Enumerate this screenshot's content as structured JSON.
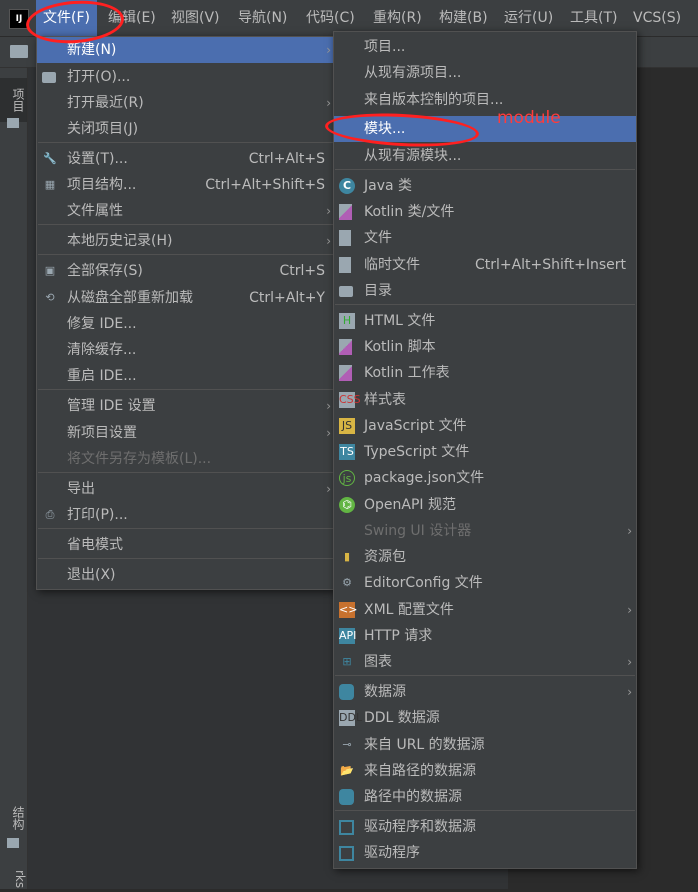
{
  "menubar": {
    "app_icon": "IJ",
    "items": [
      "文件(F)",
      "编辑(E)",
      "视图(V)",
      "导航(N)",
      "代码(C)",
      "重构(R)",
      "构建(B)",
      "运行(U)",
      "工具(T)",
      "VCS(S)"
    ]
  },
  "left_strip": {
    "project": "项目",
    "structure": "结构",
    "bookmarks": "rks"
  },
  "file_menu": {
    "items": [
      {
        "label": "新建(N)",
        "icon": "none",
        "shortcut": "",
        "submenu": true,
        "selected": true
      },
      {
        "label": "打开(O)...",
        "icon": "folder-icon",
        "shortcut": ""
      },
      {
        "label": "打开最近(R)",
        "icon": "none",
        "shortcut": "",
        "submenu": true
      },
      {
        "label": "关闭项目(J)",
        "icon": "none",
        "shortcut": ""
      },
      {
        "label": "设置(T)...",
        "icon": "wrench-icon",
        "shortcut": "Ctrl+Alt+S"
      },
      {
        "label": "项目结构...",
        "icon": "project-structure-icon",
        "shortcut": "Ctrl+Alt+Shift+S"
      },
      {
        "label": "文件属性",
        "icon": "none",
        "shortcut": "",
        "submenu": true
      },
      {
        "label": "本地历史记录(H)",
        "icon": "none",
        "shortcut": "",
        "submenu": true
      },
      {
        "label": "全部保存(S)",
        "icon": "save-icon",
        "shortcut": "Ctrl+S"
      },
      {
        "label": "从磁盘全部重新加载",
        "icon": "reload-icon",
        "shortcut": "Ctrl+Alt+Y"
      },
      {
        "label": "修复 IDE...",
        "icon": "none",
        "shortcut": ""
      },
      {
        "label": "清除缓存...",
        "icon": "none",
        "shortcut": ""
      },
      {
        "label": "重启 IDE...",
        "icon": "none",
        "shortcut": ""
      },
      {
        "label": "管理 IDE 设置",
        "icon": "none",
        "shortcut": "",
        "submenu": true
      },
      {
        "label": "新项目设置",
        "icon": "none",
        "shortcut": "",
        "submenu": true
      },
      {
        "label": "将文件另存为模板(L)...",
        "icon": "none",
        "shortcut": "",
        "disabled": true
      },
      {
        "label": "导出",
        "icon": "none",
        "shortcut": "",
        "submenu": true
      },
      {
        "label": "打印(P)...",
        "icon": "print-icon",
        "shortcut": ""
      },
      {
        "label": "省电模式",
        "icon": "none",
        "shortcut": ""
      },
      {
        "label": "退出(X)",
        "icon": "none",
        "shortcut": ""
      }
    ]
  },
  "new_menu": {
    "items": [
      {
        "label": "项目...",
        "icon": "none"
      },
      {
        "label": "从现有源项目...",
        "icon": "none"
      },
      {
        "label": "来自版本控制的项目...",
        "icon": "none"
      },
      {
        "label": "模块...",
        "icon": "none",
        "selected": true
      },
      {
        "label": "从现有源模块...",
        "icon": "none"
      },
      {
        "label": "Java 类",
        "icon": "java-class-icon"
      },
      {
        "label": "Kotlin 类/文件",
        "icon": "kotlin-icon"
      },
      {
        "label": "文件",
        "icon": "file-icon"
      },
      {
        "label": "临时文件",
        "icon": "scratch-file-icon",
        "shortcut": "Ctrl+Alt+Shift+Insert"
      },
      {
        "label": "目录",
        "icon": "folder-icon"
      },
      {
        "label": "HTML 文件",
        "icon": "html-icon"
      },
      {
        "label": "Kotlin 脚本",
        "icon": "kotlin-icon"
      },
      {
        "label": "Kotlin 工作表",
        "icon": "kotlin-icon"
      },
      {
        "label": "样式表",
        "icon": "css-icon"
      },
      {
        "label": "JavaScript 文件",
        "icon": "js-icon"
      },
      {
        "label": "TypeScript 文件",
        "icon": "ts-icon"
      },
      {
        "label": "package.json文件",
        "icon": "package-json-icon"
      },
      {
        "label": "OpenAPI 规范",
        "icon": "openapi-icon"
      },
      {
        "label": "Swing UI 设计器",
        "icon": "none",
        "disabled": true,
        "submenu": true
      },
      {
        "label": "资源包",
        "icon": "resource-bundle-icon"
      },
      {
        "label": "EditorConfig 文件",
        "icon": "gear-icon"
      },
      {
        "label": "XML 配置文件",
        "icon": "xml-icon",
        "submenu": true
      },
      {
        "label": "HTTP 请求",
        "icon": "http-icon"
      },
      {
        "label": "图表",
        "icon": "diagram-icon",
        "submenu": true
      },
      {
        "label": "数据源",
        "icon": "database-icon",
        "submenu": true
      },
      {
        "label": "DDL 数据源",
        "icon": "ddl-icon"
      },
      {
        "label": "来自 URL 的数据源",
        "icon": "url-icon"
      },
      {
        "label": "来自路径的数据源",
        "icon": "folder-open-icon"
      },
      {
        "label": "路径中的数据源",
        "icon": "database-icon"
      },
      {
        "label": "驱动程序和数据源",
        "icon": "driver-icon"
      },
      {
        "label": "驱动程序",
        "icon": "driver-icon"
      }
    ]
  },
  "annotation": {
    "text": "module",
    "color": "#ff2020"
  },
  "colors": {
    "selection": "#4b6eaf",
    "menu_bg": "#3c3f41",
    "editor_bg": "#2b2b2b"
  }
}
